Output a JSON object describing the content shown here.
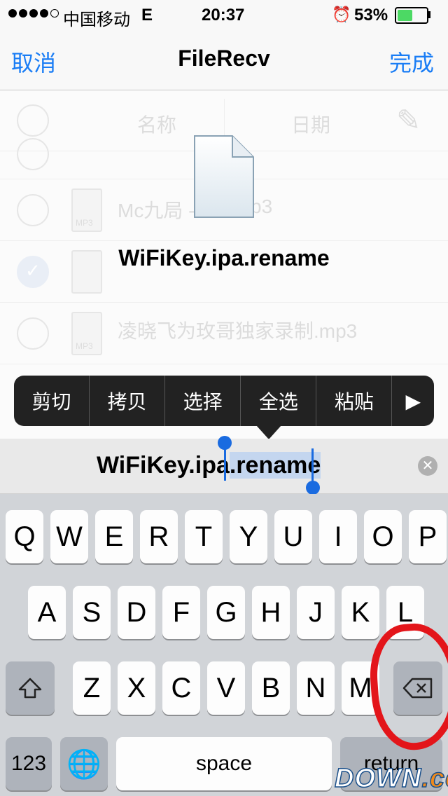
{
  "status_bar": {
    "carrier": "中国移动",
    "network": "E",
    "time": "20:37",
    "battery_percent": "53%",
    "battery_level": 0.53
  },
  "nav": {
    "cancel": "取消",
    "title": "FileRecv",
    "done": "完成"
  },
  "list": {
    "header_name": "名称",
    "header_date": "日期",
    "rows": [
      {
        "name": "Mc九局 -",
        "suffix": "p3"
      },
      {
        "name": "凌晓飞为玫哥独家录制.mp3"
      }
    ],
    "icon_label": "MP3"
  },
  "rename": {
    "filename": "WiFiKey.ipa.rename"
  },
  "context_menu": {
    "items": [
      "剪切",
      "拷贝",
      "选择",
      "全选",
      "粘贴"
    ],
    "more": "▶"
  },
  "input": {
    "prefix": "WiFiKey.ipa",
    "selected": ".rename"
  },
  "keyboard": {
    "row1": [
      "Q",
      "W",
      "E",
      "R",
      "T",
      "Y",
      "U",
      "I",
      "O",
      "P"
    ],
    "row2": [
      "A",
      "S",
      "D",
      "F",
      "G",
      "H",
      "J",
      "K",
      "L"
    ],
    "row3": [
      "Z",
      "X",
      "C",
      "V",
      "B",
      "N",
      "M"
    ],
    "numbers": "123",
    "space": "space",
    "return": "return"
  },
  "watermark": {
    "main": "DOWN",
    "suffix": ".cc"
  },
  "colors": {
    "accent": "#1a7df5",
    "menu_bg": "#222222",
    "selection": "#c4d6ef",
    "annotation": "#e3151a"
  }
}
